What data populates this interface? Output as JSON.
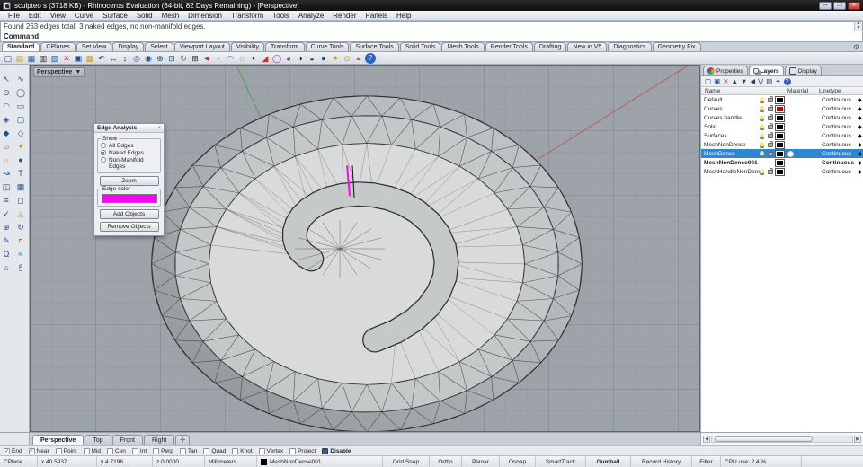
{
  "window": {
    "title": "sculpteo s (3718 KB) - Rhinoceros Evaluation (64-bit, 82 Days Remaining) - [Perspective]",
    "controls": {
      "minimize": "—",
      "restore": "❐",
      "close": "✕"
    }
  },
  "menu": {
    "items": [
      "File",
      "Edit",
      "View",
      "Curve",
      "Surface",
      "Solid",
      "Mesh",
      "Dimension",
      "Transform",
      "Tools",
      "Analyze",
      "Render",
      "Panels",
      "Help"
    ]
  },
  "command": {
    "history": "Found 263 edges total, 3 naked edges, no non-manifold edges.",
    "prompt": "Command:"
  },
  "workspace_tabs": {
    "active": "Standard",
    "items": [
      "Standard",
      "CPlanes",
      "Set View",
      "Display",
      "Select",
      "Viewport Layout",
      "Visibility",
      "Transform",
      "Curve Tools",
      "Surface Tools",
      "Solid Tools",
      "Mesh Tools",
      "Render Tools",
      "Drafting",
      "New in V5",
      "Diagnostics",
      "Geometry Fix"
    ]
  },
  "icons": {
    "top": [
      "▢",
      "▤",
      "▦",
      "▥",
      "▧",
      "✕",
      "▣",
      "▩",
      "↶",
      "↔",
      "↕",
      "◎",
      "◉",
      "⊕",
      "⊡",
      "↻",
      "⊞",
      "◄",
      "∙",
      "◠",
      "☼",
      "▪",
      "◢",
      "◯",
      "◕",
      "◑",
      "◒",
      "●",
      "✦",
      "⊙",
      "≡",
      "?"
    ],
    "left": [
      "↖",
      "∿",
      "⊙",
      "◯",
      "◠",
      "▭",
      "◈",
      "▢",
      "◆",
      "◇",
      "⊿",
      "✦",
      "☼",
      "●",
      "↝",
      "T",
      "◫",
      "▦",
      "≡",
      "◻",
      "✓",
      "◬",
      "⊕",
      "↻",
      "✎",
      "¤",
      "Ω",
      "≈",
      "⌂",
      "§"
    ],
    "panel": [
      "▢",
      "▣",
      "✕",
      "▲",
      "▼",
      "◀",
      "⋁",
      "▤",
      "✦",
      "?"
    ]
  },
  "viewport": {
    "label": "Perspective",
    "caret": "▼",
    "bg_color": "#9da3a9",
    "grid_color": "#6e8091",
    "axis_x_color": "#b35f5f",
    "axis_y_color": "#4f9e52",
    "naked_edge_color": "#ff00ff"
  },
  "edge_analysis": {
    "title": "Edge Analysis",
    "close": "×",
    "show_label": "Show",
    "options": [
      "All Edges",
      "Naked Edges",
      "Non-Manifold Edges"
    ],
    "selected": "Naked Edges",
    "zoom_button": "Zoom",
    "edge_color_label": "Edge color",
    "edge_color": "#FF00FF",
    "add_button": "Add Objects",
    "remove_button": "Remove Objects"
  },
  "panel": {
    "tabs": [
      "Properties",
      "Layers",
      "Display"
    ],
    "active_tab": "Layers",
    "columns": {
      "name": "Name",
      "material": "Material",
      "linetype": "Linetype"
    },
    "layers": [
      {
        "name": "Default",
        "linetype": "Continuous",
        "color": "#000000",
        "visible": true,
        "locked": false
      },
      {
        "name": "Curves",
        "linetype": "Continuous",
        "color": "#cc0000",
        "visible": true,
        "locked": false
      },
      {
        "name": "Curves handle",
        "linetype": "Continuous",
        "color": "#000000",
        "visible": true,
        "locked": false
      },
      {
        "name": "Solid",
        "linetype": "Continuous",
        "color": "#000000",
        "visible": true,
        "locked": false
      },
      {
        "name": "Surfaces",
        "linetype": "Continuous",
        "color": "#000000",
        "visible": true,
        "locked": false
      },
      {
        "name": "MeshNonDense",
        "linetype": "Continuous",
        "color": "#000000",
        "visible": true,
        "locked": false
      },
      {
        "name": "MeshDense",
        "linetype": "Continuous",
        "color": "#000000",
        "visible": true,
        "locked": false,
        "selected": true
      },
      {
        "name": "MeshNonDense001",
        "linetype": "Continuous",
        "color": "#000000",
        "current": true,
        "check": "✓"
      },
      {
        "name": "MeshHandleNonDense",
        "linetype": "Continuous",
        "color": "#000000",
        "visible": true,
        "locked": false
      }
    ]
  },
  "viewport_tabs": {
    "active": "Perspective",
    "items": [
      "Perspective",
      "Top",
      "Front",
      "Right"
    ],
    "new_tab": "✛"
  },
  "osnap": {
    "items": [
      {
        "label": "End",
        "checked": true
      },
      {
        "label": "Near",
        "checked": true
      },
      {
        "label": "Point",
        "checked": false
      },
      {
        "label": "Mid",
        "checked": false
      },
      {
        "label": "Cen",
        "checked": false
      },
      {
        "label": "Int",
        "checked": false
      },
      {
        "label": "Perp",
        "checked": false
      },
      {
        "label": "Tan",
        "checked": false
      },
      {
        "label": "Quad",
        "checked": false
      },
      {
        "label": "Knot",
        "checked": false
      },
      {
        "label": "Vertex",
        "checked": false
      },
      {
        "label": "Project",
        "checked": false
      },
      {
        "label": "Disable",
        "checked": false,
        "dark": true
      }
    ]
  },
  "statusbar": {
    "cplane": "CPlane",
    "x": "x 40.5937",
    "y": "y 4.7196",
    "z": "z 0.0000",
    "units": "Millimeters",
    "layer": "MeshNonDense001",
    "panes": [
      "Grid Snap",
      "Ortho",
      "Planar",
      "Osnap",
      "SmartTrack",
      "Gumball",
      "Record History",
      "Filter"
    ],
    "cpu": "CPU use: 2.4 %"
  }
}
